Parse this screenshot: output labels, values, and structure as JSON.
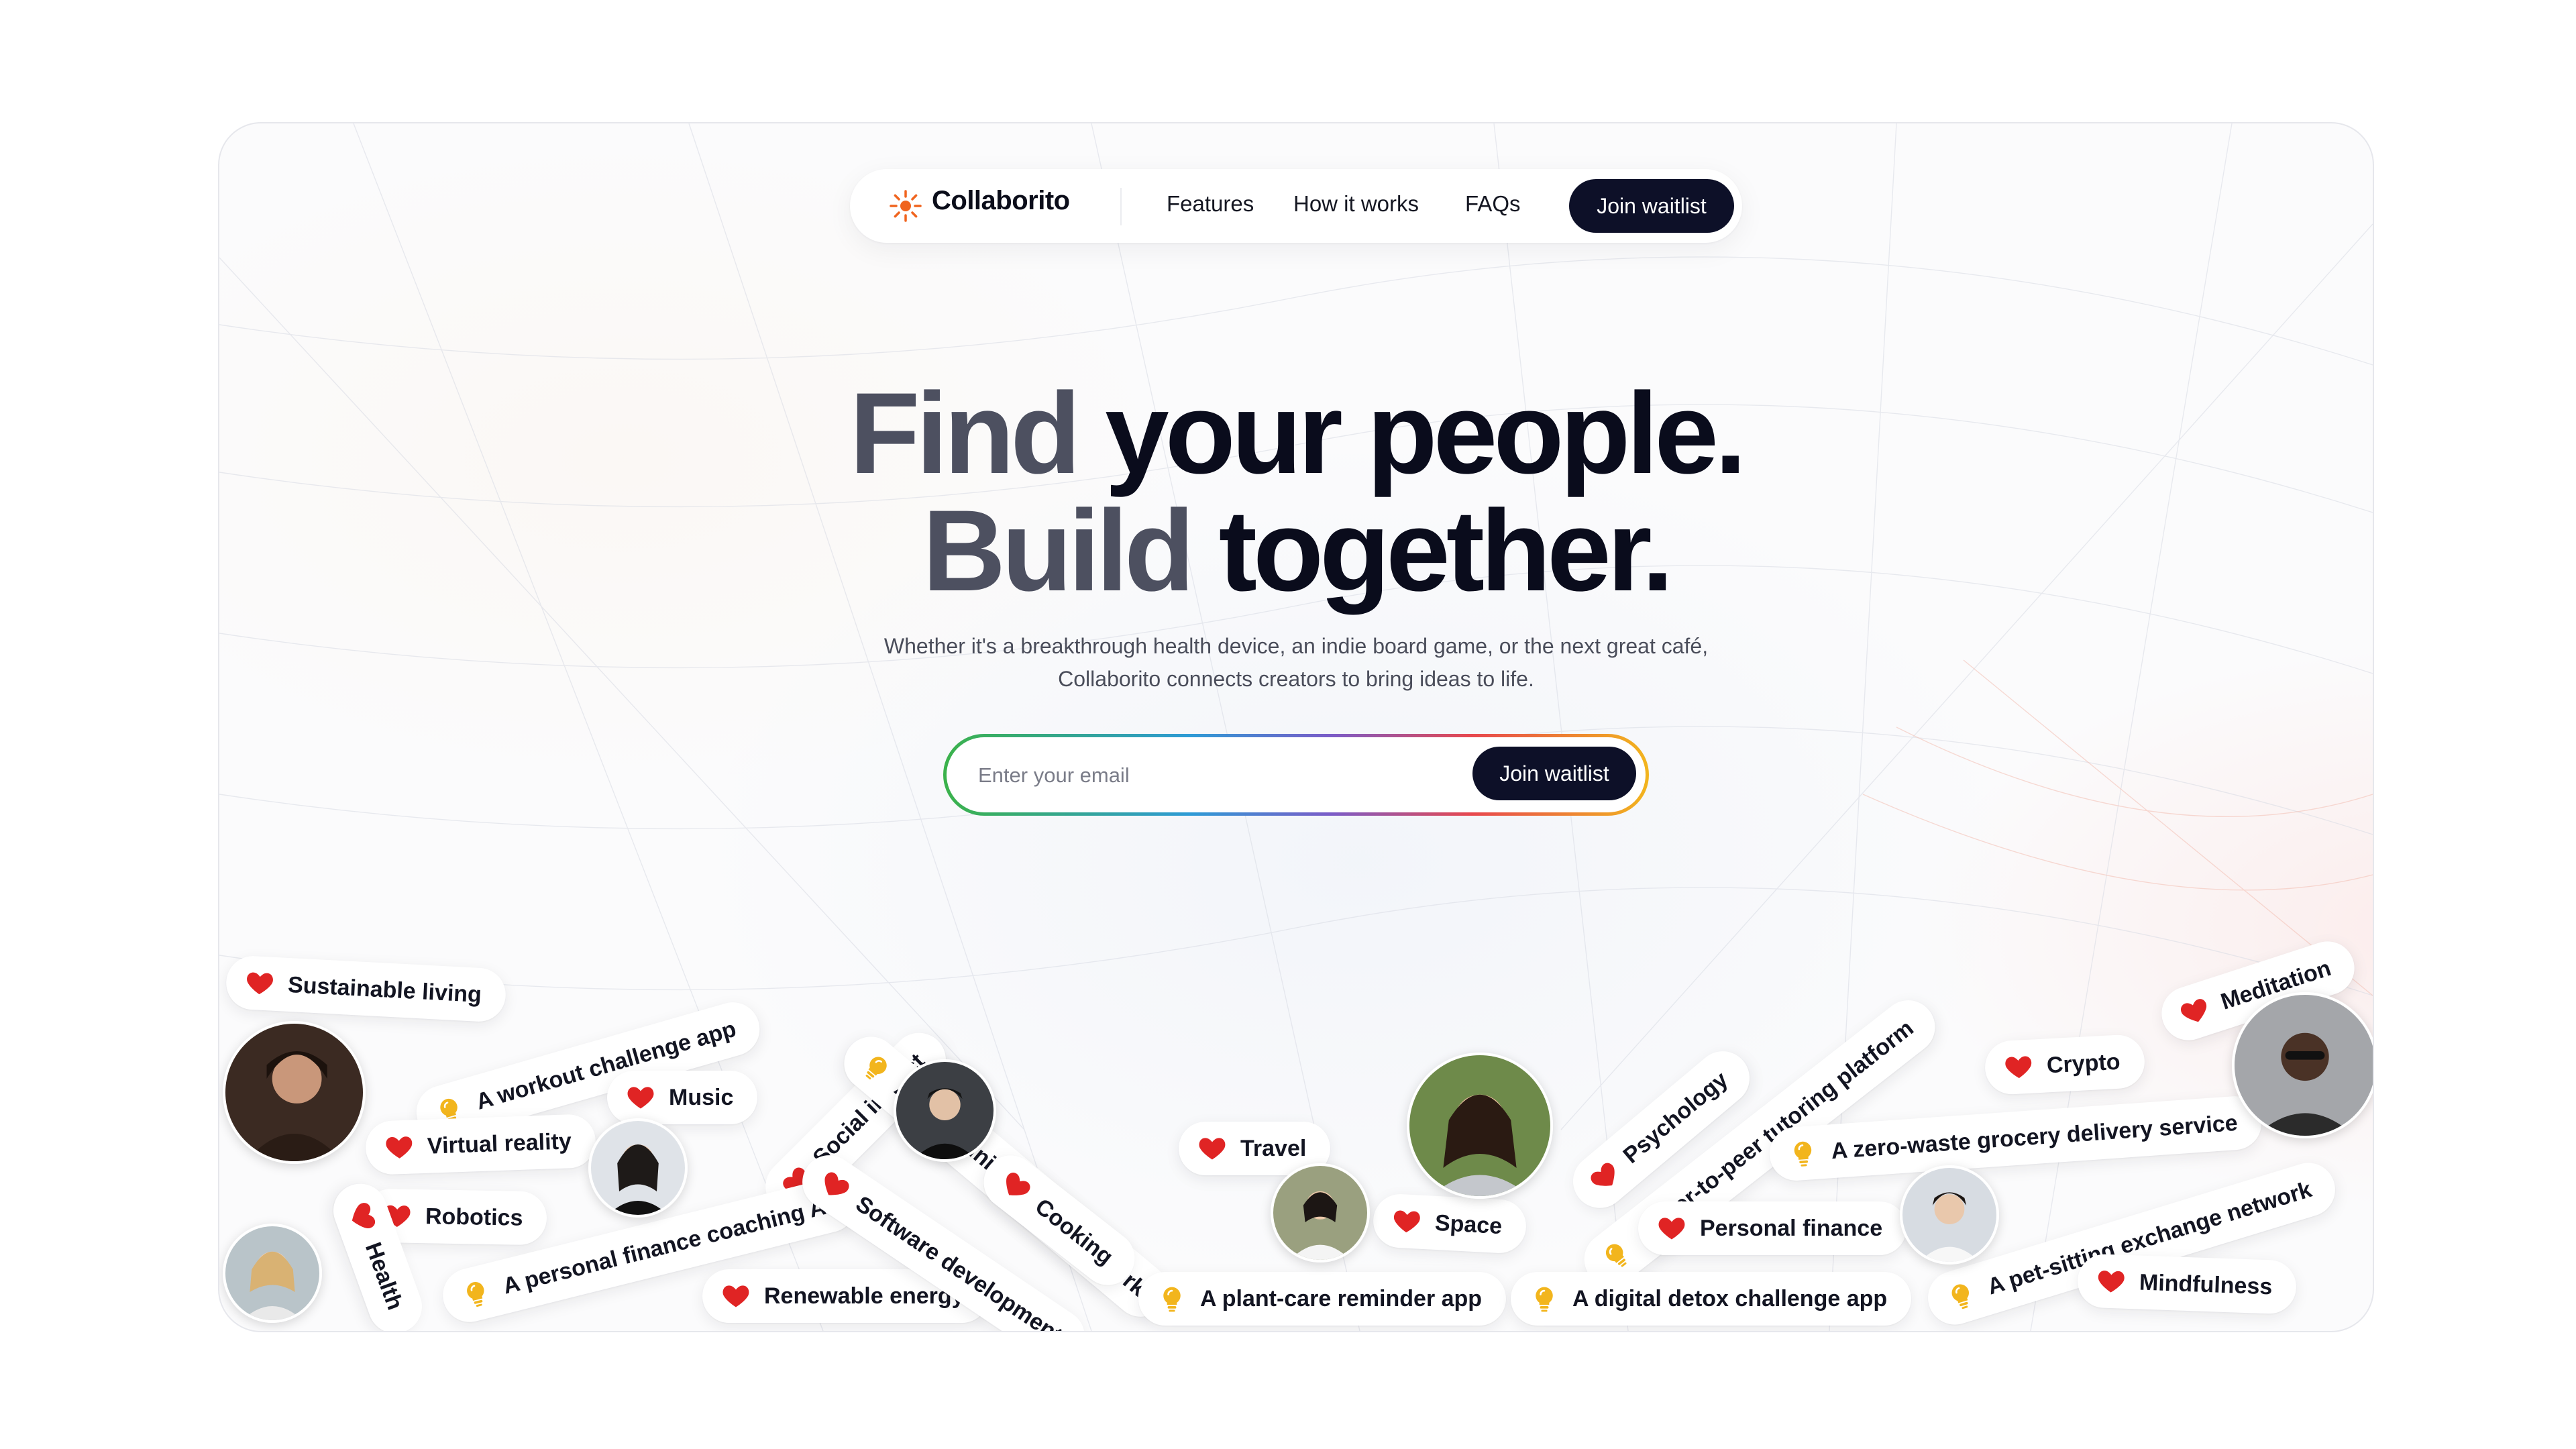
{
  "nav": {
    "brand": "Collaborito",
    "links": [
      "Features",
      "How it works",
      "FAQs"
    ],
    "cta": "Join waitlist"
  },
  "hero": {
    "line1_grey": "Find",
    "line1_dark": "your people.",
    "line2_grey": "Build",
    "line2_dark": "together.",
    "subtitle_line1": "Whether it's a breakthrough health device, an indie board game, or the next great café,",
    "subtitle_line2": "Collaborito connects creators to bring ideas to life."
  },
  "signup": {
    "placeholder": "Enter your email",
    "button": "Join waitlist"
  },
  "tags": [
    {
      "label": "Sustainable living",
      "icon": "heart-icon"
    },
    {
      "label": "A workout challenge app",
      "icon": "lightbulb-icon"
    },
    {
      "label": "Music",
      "icon": "heart-icon"
    },
    {
      "label": "Social impact",
      "icon": "heart-icon"
    },
    {
      "label": "A community garden network",
      "icon": "lightbulb-icon"
    },
    {
      "label": "Virtual reality",
      "icon": "heart-icon"
    },
    {
      "label": "Robotics",
      "icon": "heart-icon"
    },
    {
      "label": "Health",
      "icon": "heart-icon"
    },
    {
      "label": "A personal finance coaching AI",
      "icon": "lightbulb-icon"
    },
    {
      "label": "Renewable energy",
      "icon": "heart-icon"
    },
    {
      "label": "Software development",
      "icon": "heart-icon"
    },
    {
      "label": "Cooking",
      "icon": "heart-icon"
    },
    {
      "label": "Travel",
      "icon": "heart-icon"
    },
    {
      "label": "A plant-care reminder app",
      "icon": "lightbulb-icon"
    },
    {
      "label": "Space",
      "icon": "heart-icon"
    },
    {
      "label": "Psychology",
      "icon": "heart-icon"
    },
    {
      "label": "A peer-to-peer tutoring platform",
      "icon": "lightbulb-icon"
    },
    {
      "label": "Personal finance",
      "icon": "heart-icon"
    },
    {
      "label": "A digital detox challenge app",
      "icon": "lightbulb-icon"
    },
    {
      "label": "Crypto",
      "icon": "heart-icon"
    },
    {
      "label": "A zero-waste grocery delivery service",
      "icon": "lightbulb-icon"
    },
    {
      "label": "Meditation",
      "icon": "heart-icon"
    },
    {
      "label": "A pet-sitting exchange network",
      "icon": "lightbulb-icon"
    },
    {
      "label": "Mindfulness",
      "icon": "heart-icon"
    }
  ],
  "colors": {
    "heart": "#e02424",
    "bulb": "#f2b51d",
    "button": "#0d1028",
    "logo": "#f0641e"
  }
}
